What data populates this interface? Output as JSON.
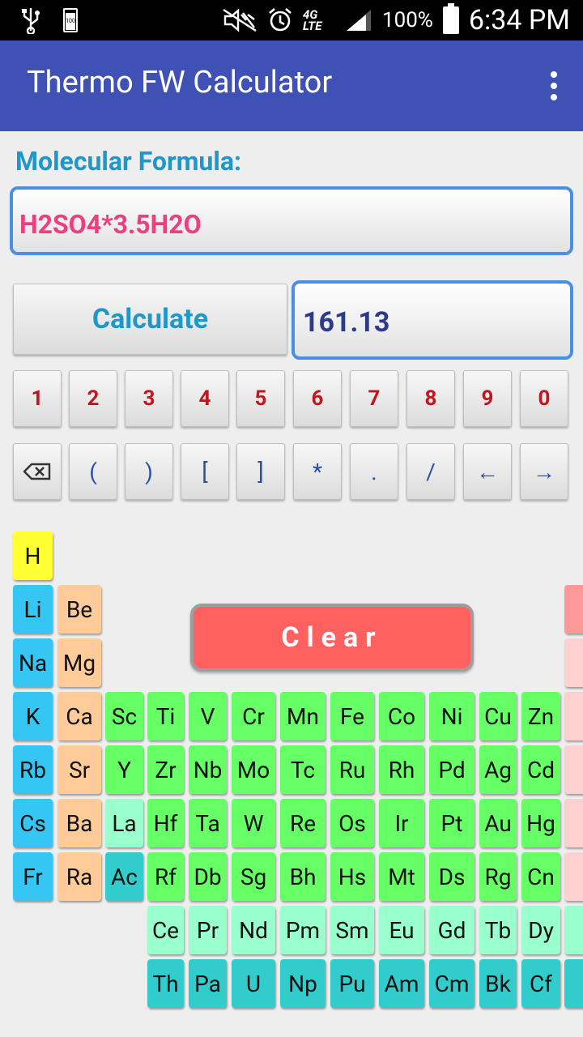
{
  "status_bar": {
    "battery_small_label": "100",
    "network": "4G LTE",
    "battery_percent": "100%",
    "time": "6:34 PM"
  },
  "app_bar": {
    "title": "Thermo FW Calculator"
  },
  "form": {
    "label": "Molecular Formula:",
    "formula_value": "H2SO4*3.5H2O",
    "calculate_label": "Calculate",
    "result_value": "161.13"
  },
  "keypad": {
    "digits": [
      "1",
      "2",
      "3",
      "4",
      "5",
      "6",
      "7",
      "8",
      "9",
      "0"
    ],
    "symbols": [
      "backspace",
      "(",
      ")",
      "[",
      "]",
      "*",
      ".",
      "/",
      "←",
      "→"
    ]
  },
  "clear_label": "Clear",
  "elements": {
    "H": "H",
    "Li": "Li",
    "Be": "Be",
    "Na": "Na",
    "Mg": "Mg",
    "K": "K",
    "Ca": "Ca",
    "Sc": "Sc",
    "Ti": "Ti",
    "V": "V",
    "Cr": "Cr",
    "Mn": "Mn",
    "Fe": "Fe",
    "Co": "Co",
    "Ni": "Ni",
    "Cu": "Cu",
    "Zn": "Zn",
    "Rb": "Rb",
    "Sr": "Sr",
    "Y": "Y",
    "Zr": "Zr",
    "Nb": "Nb",
    "Mo": "Mo",
    "Tc": "Tc",
    "Ru": "Ru",
    "Rh": "Rh",
    "Pd": "Pd",
    "Ag": "Ag",
    "Cd": "Cd",
    "Cs": "Cs",
    "Ba": "Ba",
    "La": "La",
    "Hf": "Hf",
    "Ta": "Ta",
    "W": "W",
    "Re": "Re",
    "Os": "Os",
    "Ir": "Ir",
    "Pt": "Pt",
    "Au": "Au",
    "Hg": "Hg",
    "Fr": "Fr",
    "Ra": "Ra",
    "Ac": "Ac",
    "Rf": "Rf",
    "Db": "Db",
    "Sg": "Sg",
    "Bh": "Bh",
    "Hs": "Hs",
    "Mt": "Mt",
    "Ds": "Ds",
    "Rg": "Rg",
    "Cn": "Cn",
    "Ce": "Ce",
    "Pr": "Pr",
    "Nd": "Nd",
    "Pm": "Pm",
    "Sm": "Sm",
    "Eu": "Eu",
    "Gd": "Gd",
    "Tb": "Tb",
    "Dy": "Dy",
    "Th": "Th",
    "Pa": "Pa",
    "U": "U",
    "Np": "Np",
    "Pu": "Pu",
    "Am": "Am",
    "Cm": "Cm",
    "Bk": "Bk",
    "Cf": "Cf"
  }
}
